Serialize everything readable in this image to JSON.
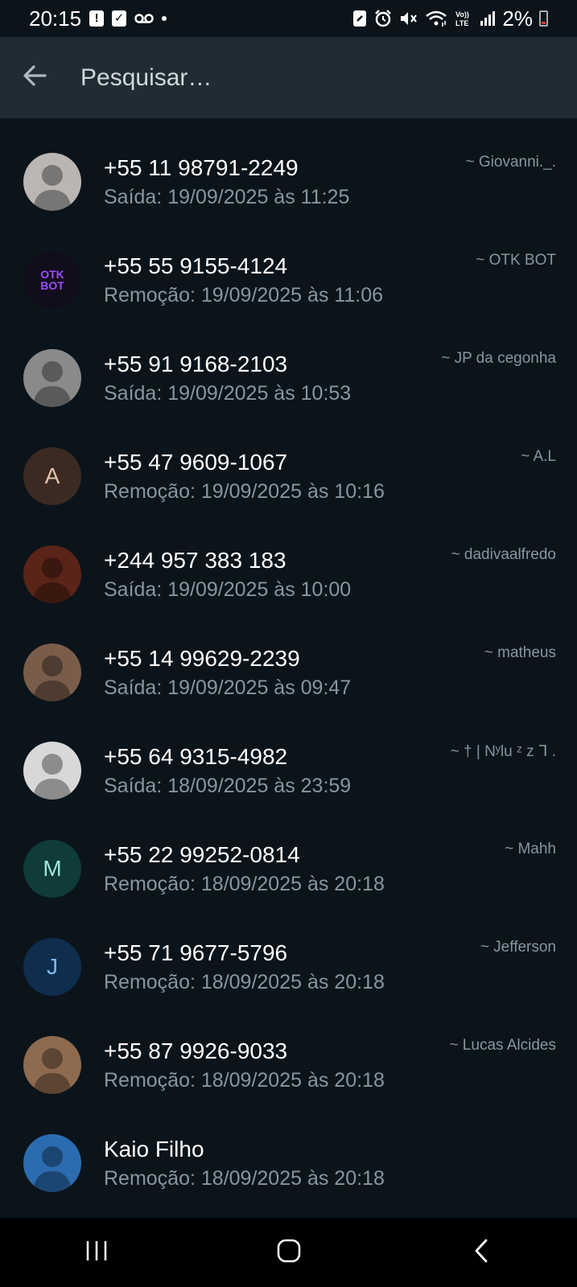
{
  "status_bar": {
    "time": "20:15",
    "battery": "2%",
    "icons": [
      "alert-icon",
      "check-box-icon",
      "voicemail-icon",
      "dot-icon",
      "nfc-icon",
      "alarm-icon",
      "mute-icon",
      "wifi-icon",
      "volte-icon",
      "signal-icon",
      "battery-icon"
    ]
  },
  "app_bar": {
    "back_icon": "arrow-back-icon",
    "search_placeholder": "Pesquisar…"
  },
  "colors": {
    "background": "#0b141a",
    "app_bar": "#1f2c33",
    "primary_text": "#ffffff",
    "secondary_text": "#8696a0"
  },
  "entries": [
    {
      "name": "+55 11 98791-2249",
      "detail": "Saída: 19/09/2025 às 11:25",
      "alias": "~ Giovanni._.",
      "avatar": {
        "type": "photo",
        "bg": "#b9b6b3"
      }
    },
    {
      "name": "+55 55 9155-4124",
      "detail": "Remoção: 19/09/2025 às 11:06",
      "alias": "~ OTK BOT",
      "avatar": {
        "type": "logo",
        "text": "OTK BOT",
        "bg": "#120d1c"
      }
    },
    {
      "name": "+55 91 9168-2103",
      "detail": "Saída: 19/09/2025 às 10:53",
      "alias": "~ JP da cegonha",
      "avatar": {
        "type": "photo",
        "bg": "#8a8a8a"
      }
    },
    {
      "name": "+55 47 9609-1067",
      "detail": "Remoção: 19/09/2025 às 10:16",
      "alias": "~ A.L",
      "avatar": {
        "type": "letter",
        "letter": "A",
        "bg": "#3b2a21",
        "fg": "#e2c2ad"
      }
    },
    {
      "name": "+244 957 383 183",
      "detail": "Saída: 19/09/2025 às 10:00",
      "alias": "~ dadivaalfredo",
      "avatar": {
        "type": "photo",
        "bg": "#5a2418"
      }
    },
    {
      "name": "+55 14 99629-2239",
      "detail": "Saída: 19/09/2025 às 09:47",
      "alias": "~ matheus",
      "avatar": {
        "type": "photo",
        "bg": "#7a5c4a"
      }
    },
    {
      "name": "+55 64 9315-4982",
      "detail": "Saída: 18/09/2025 às 23:59",
      "alias": "~ † | Nʸlu ᶻ z ᒣ .",
      "avatar": {
        "type": "photo",
        "bg": "#d8d8d8"
      }
    },
    {
      "name": "+55 22 99252-0814",
      "detail": "Remoção: 18/09/2025 às 20:18",
      "alias": "~ Mahh",
      "avatar": {
        "type": "letter",
        "letter": "M",
        "bg": "#0f3b3a",
        "fg": "#9fe3d9"
      }
    },
    {
      "name": "+55 71 9677-5796",
      "detail": "Remoção: 18/09/2025 às 20:18",
      "alias": "~  Jefferson",
      "avatar": {
        "type": "letter",
        "letter": "J",
        "bg": "#0f2d4d",
        "fg": "#7fb7ea"
      }
    },
    {
      "name": "+55 87 9926-9033",
      "detail": "Remoção: 18/09/2025 às 20:18",
      "alias": "~ Lucas Alcides",
      "avatar": {
        "type": "photo",
        "bg": "#8e6a4f"
      }
    },
    {
      "name": "Kaio Filho",
      "detail": "Remoção: 18/09/2025 às 20:18",
      "alias": "",
      "avatar": {
        "type": "photo",
        "bg": "#2b6cb0"
      }
    }
  ],
  "nav_bar": {
    "icons": [
      "recent-apps-icon",
      "home-icon",
      "back-icon"
    ]
  }
}
